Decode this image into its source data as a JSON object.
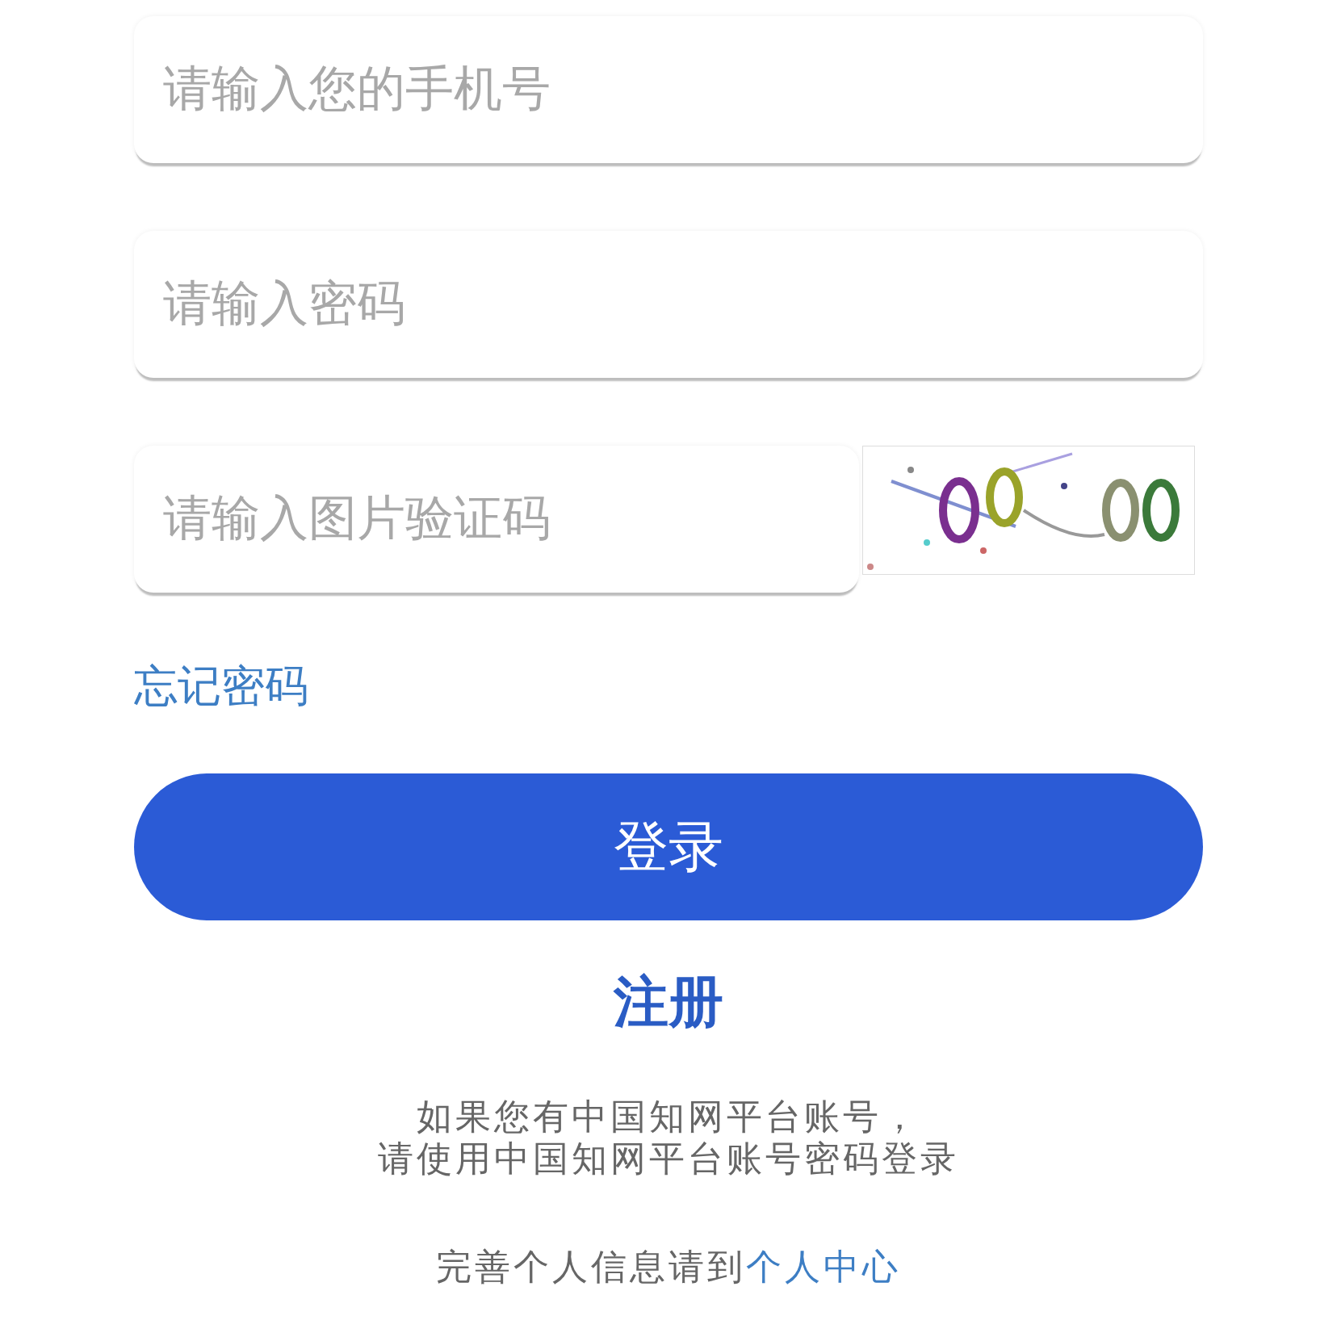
{
  "fields": [
    {
      "kind": "text",
      "placeholder": "请输入您的手机号"
    },
    {
      "kind": "password",
      "placeholder": "请输入密码"
    },
    {
      "kind": "captcha",
      "placeholder": "请输入图片验证码"
    }
  ],
  "forgot_link": "忘记密码",
  "login_button": "登录",
  "register_link": "注册",
  "notice_lines": [
    "如果您有中国知网平台账号，",
    "请使用中国知网平台账号密码登录"
  ],
  "profile_hint": {
    "text": "完善个人信息请到",
    "link": "个人中心"
  }
}
